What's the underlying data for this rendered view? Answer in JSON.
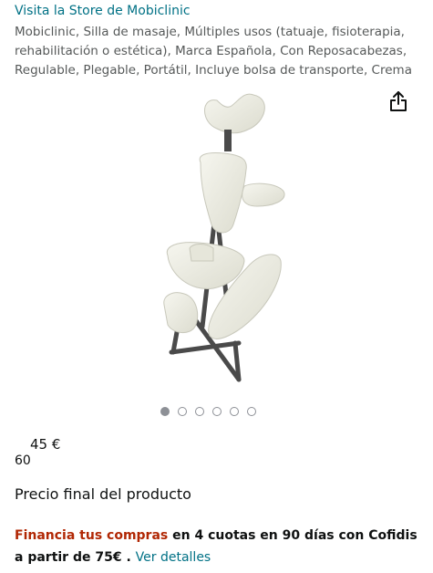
{
  "store": {
    "link_text": "Visita la Store de Mobiclinic"
  },
  "product": {
    "title": "Mobiclinic, Silla de masaje, Múltiples usos (tatuaje, fisioterapia, rehabilitación o estética), Marca Española, Con Reposacabezas, Regulable, Plegable, Portátil, Incluye bolsa de transporte, Crema"
  },
  "carousel": {
    "total": 6,
    "active_index": 0
  },
  "price": {
    "main": "45 €",
    "secondary": "60"
  },
  "final_price_label": "Precio final del producto",
  "financing": {
    "link_text": "Financia tus compras",
    "text": " en 4 cuotas en 90 días con Cofidis a partir de 75€",
    "separator": " . ",
    "details_link": "Ver detalles"
  },
  "icons": {
    "share": "share-icon"
  },
  "colors": {
    "link": "#007185",
    "accent_red": "#b12704",
    "chair_cream": "#eeeee4",
    "frame": "#4a4a4a"
  }
}
